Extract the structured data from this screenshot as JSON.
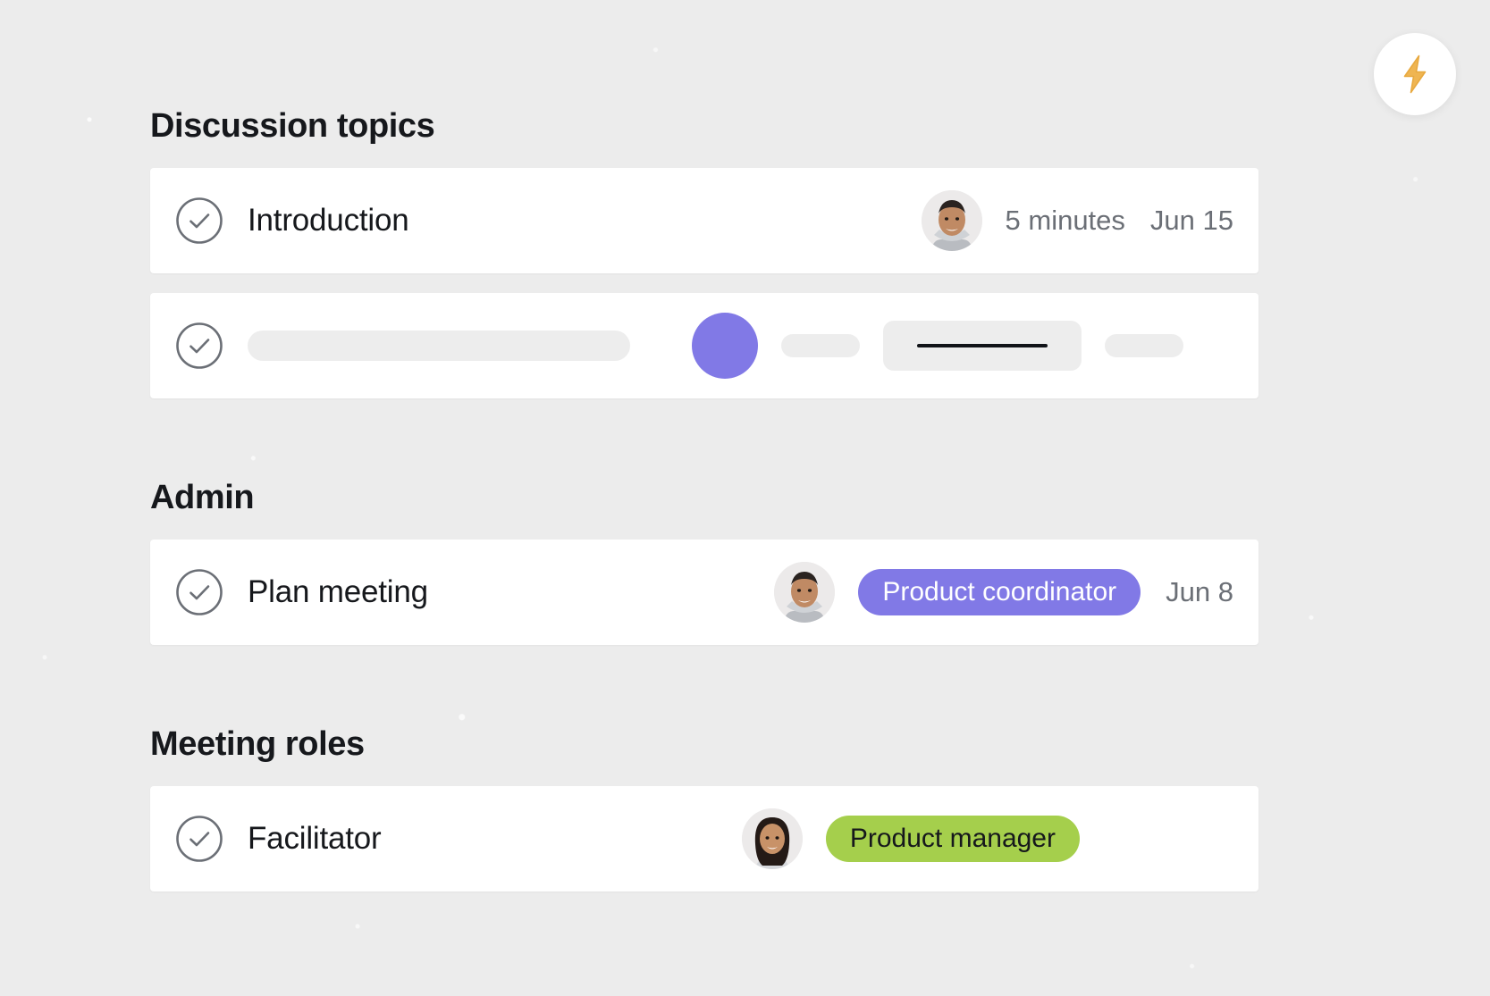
{
  "theme": {
    "background": "#ececec",
    "card_background": "#ffffff",
    "accent_purple": "#8179e6",
    "accent_green": "#a5cf4c",
    "bolt_orange": "#eeb košt"
  },
  "colors": {
    "background": "#ececec",
    "card": "#ffffff",
    "text_primary": "#16181c",
    "text_muted": "#6b6f76",
    "purple": "#8179e6",
    "green": "#a5cf4c",
    "bolt": "#efb552",
    "skeleton": "#ededed"
  },
  "action_button": {
    "name": "lightning-bolt-button",
    "icon": "lightning-bolt-icon"
  },
  "sections": [
    {
      "title": "Discussion topics",
      "rows": [
        {
          "type": "task",
          "checkbox_icon": "check-circle-icon",
          "name": "Introduction",
          "avatar": "avatar-male",
          "duration": "5 minutes",
          "date": "Jun 15"
        },
        {
          "type": "skeleton",
          "checkbox_icon": "check-circle-icon"
        }
      ]
    },
    {
      "title": "Admin",
      "rows": [
        {
          "type": "task",
          "checkbox_icon": "check-circle-icon",
          "name": "Plan meeting",
          "avatar": "avatar-male",
          "badge": "Product coordinator",
          "badge_color": "purple",
          "date": "Jun 8"
        }
      ]
    },
    {
      "title": "Meeting roles",
      "rows": [
        {
          "type": "task",
          "checkbox_icon": "check-circle-icon",
          "name": "Facilitator",
          "avatar": "avatar-female",
          "badge": "Product manager",
          "badge_color": "green"
        }
      ]
    }
  ]
}
